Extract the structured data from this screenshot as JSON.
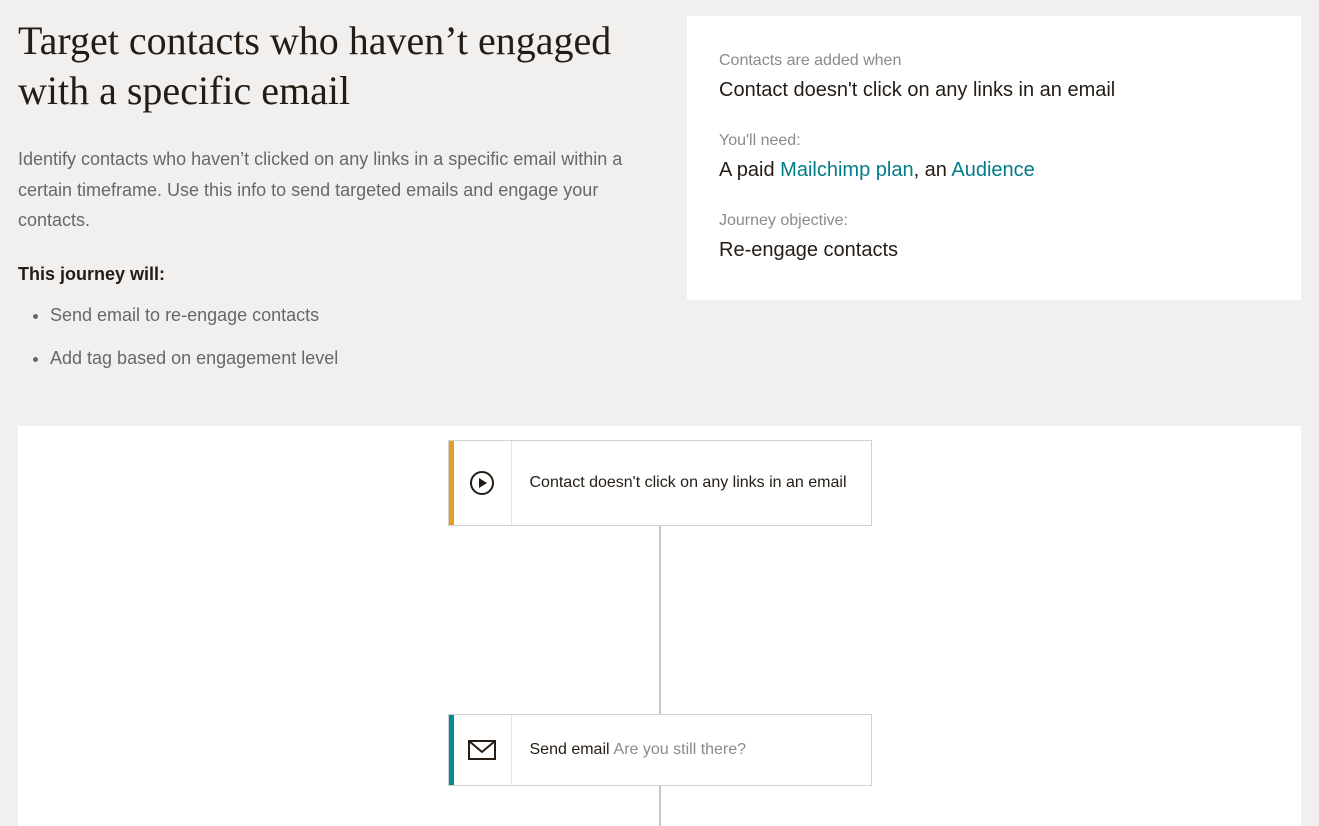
{
  "left": {
    "title": "Target contacts who haven’t engaged with a specific email",
    "description": "Identify contacts who haven’t clicked on any links in a specific email within a certain timeframe. Use this info to send targeted emails and engage your contacts.",
    "subhead": "This journey will:",
    "bullets": [
      "Send email to re-engage contacts",
      "Add tag based on engagement level"
    ]
  },
  "right": {
    "added_label": "Contacts are added when",
    "added_value": "Contact doesn't click on any links in an email",
    "need_label": "You'll need:",
    "need_prefix": "A paid ",
    "need_link1": "Mailchimp plan",
    "need_mid": ", an ",
    "need_link2": "Audience",
    "objective_label": "Journey objective:",
    "objective_value": "Re-engage contacts"
  },
  "flow": {
    "node1_text": "Contact doesn't click on any links in an email",
    "node2_label": "Send email",
    "node2_sub": "Are you still there?"
  }
}
